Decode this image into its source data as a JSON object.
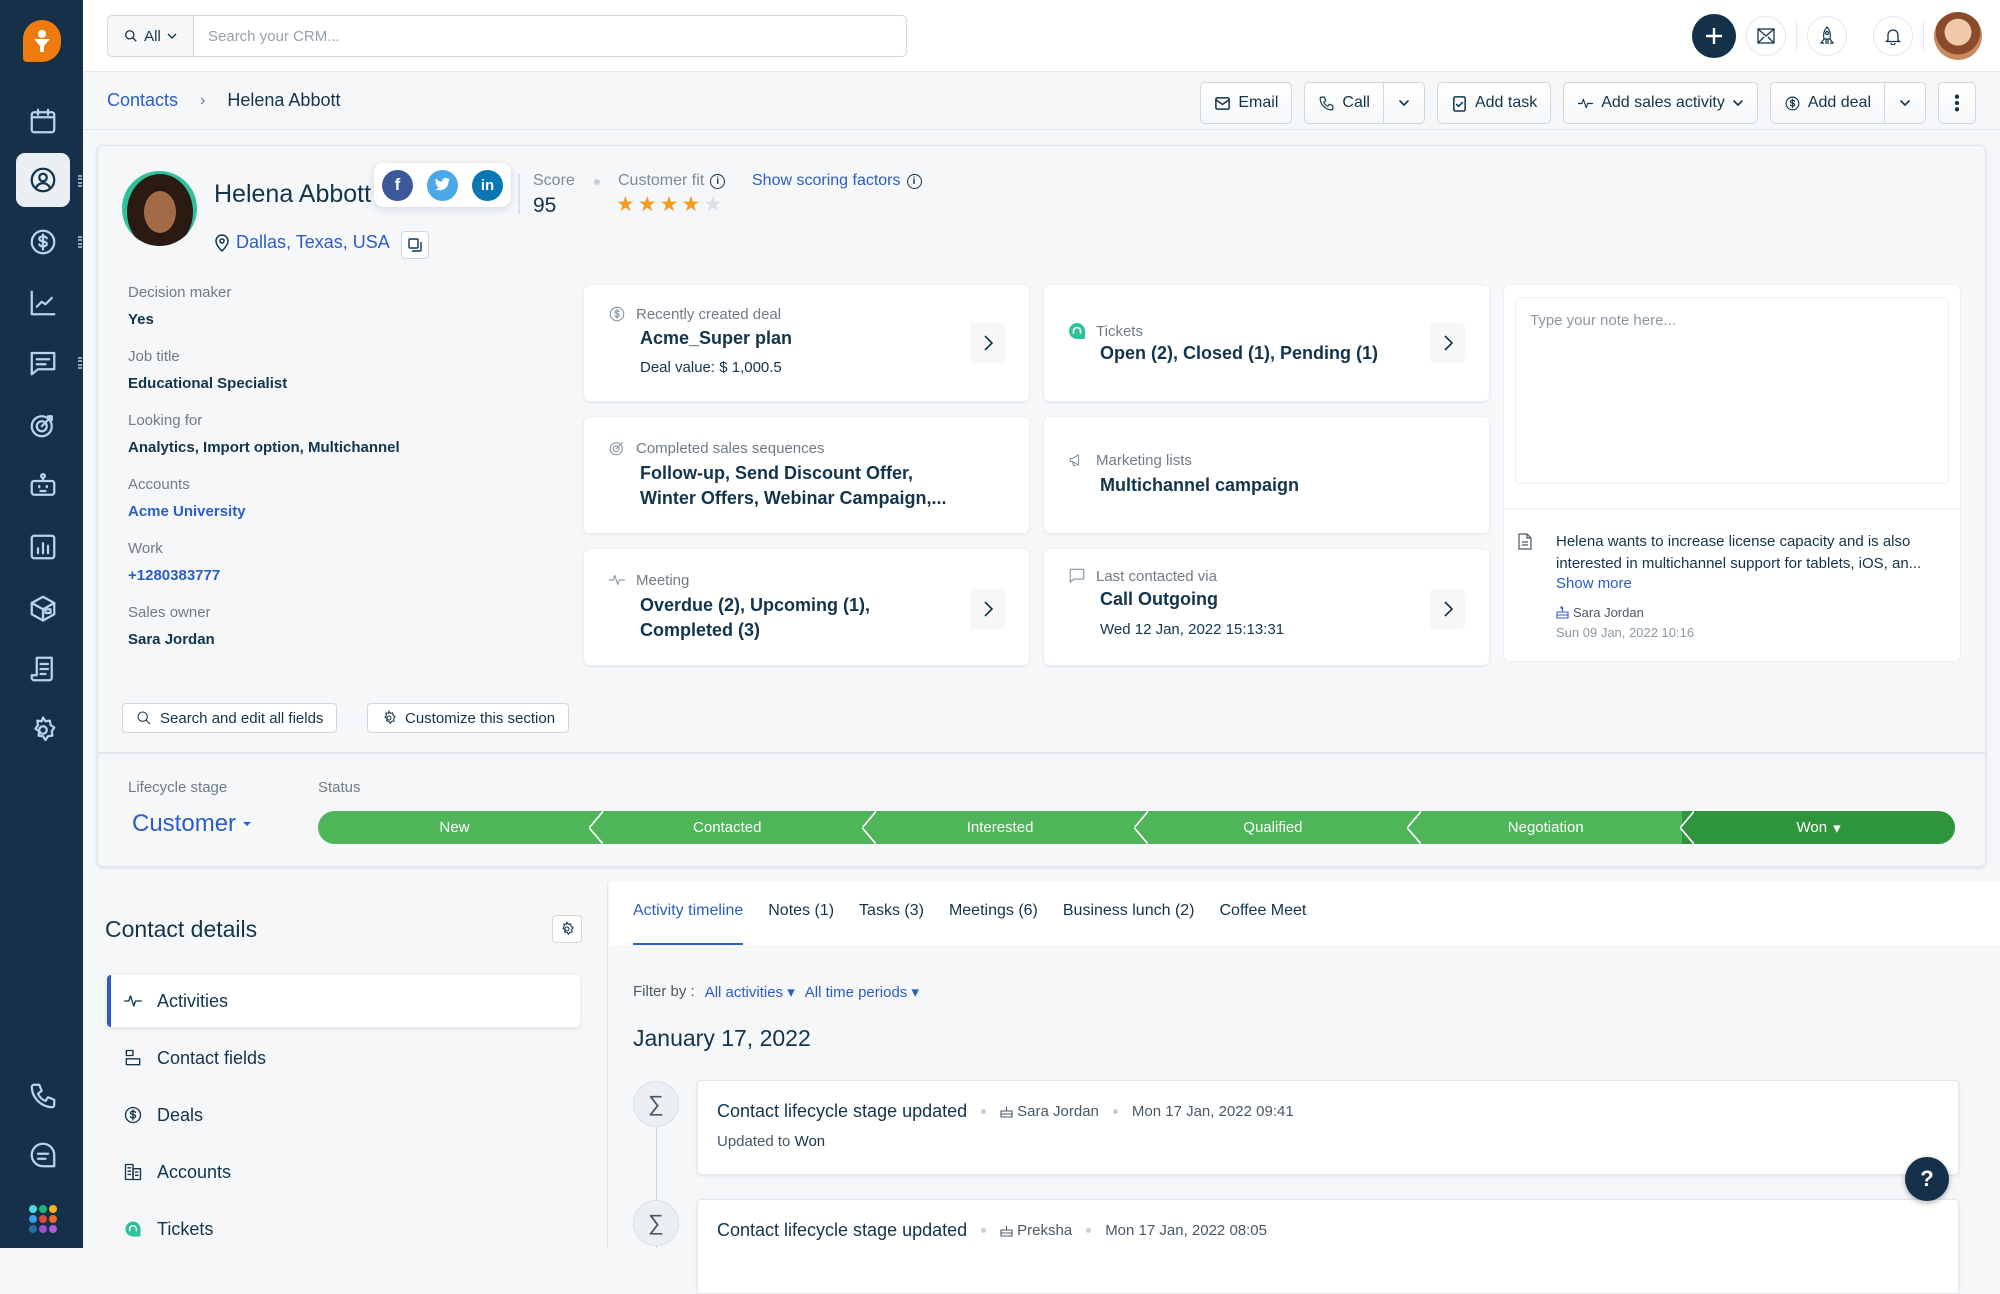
{
  "nav": {
    "items": [
      {
        "icon": "calendar-icon"
      },
      {
        "icon": "contacts-icon",
        "active": true
      },
      {
        "icon": "deals-icon"
      },
      {
        "icon": "analytics-icon"
      },
      {
        "icon": "conversations-icon"
      },
      {
        "icon": "sequences-icon"
      },
      {
        "icon": "bot-icon"
      },
      {
        "icon": "reports-icon"
      },
      {
        "icon": "products-icon"
      },
      {
        "icon": "documents-icon"
      },
      {
        "icon": "settings-icon"
      }
    ],
    "bottom": [
      {
        "icon": "phone-icon"
      },
      {
        "icon": "chat-icon"
      },
      {
        "icon": "apps-grid-icon"
      }
    ]
  },
  "topbar": {
    "search_scope": "All",
    "search_placeholder": "Search your CRM..."
  },
  "breadcrumb": {
    "parent": "Contacts",
    "current": "Helena Abbott"
  },
  "actions": {
    "email": "Email",
    "call": "Call",
    "add_task": "Add task",
    "add_sales_activity": "Add sales activity",
    "add_deal": "Add deal"
  },
  "contact": {
    "name": "Helena Abbott",
    "location": "Dallas, Texas, USA",
    "socials": [
      "facebook",
      "twitter",
      "linkedin"
    ],
    "score_label": "Score",
    "score": "95",
    "fit_label": "Customer fit",
    "fit_rating": 4,
    "fit_max": 5,
    "scoring_link": "Show scoring factors"
  },
  "fields": [
    {
      "label": "Decision maker",
      "value": "Yes"
    },
    {
      "label": "Job title",
      "value": "Educational Specialist"
    },
    {
      "label": "Looking for",
      "value": "Analytics, Import option, Multichannel"
    },
    {
      "label": "Accounts",
      "value": "Acme University",
      "link": true
    },
    {
      "label": "Work",
      "value": "+1280383777",
      "link": true
    },
    {
      "label": "Sales owner",
      "value": "Sara Jordan"
    }
  ],
  "widgets": {
    "deal": {
      "label": "Recently created deal",
      "value": "Acme_Super plan",
      "sub": "Deal value: $ 1,000.5"
    },
    "tickets": {
      "label": "Tickets",
      "value": "Open (2), Closed (1), Pending (1)"
    },
    "sequences": {
      "label": "Completed sales sequences",
      "value1": "Follow-up, Send Discount Offer,",
      "value2": "Winter Offers, Webinar Campaign,..."
    },
    "marketing": {
      "label": "Marketing lists",
      "value": "Multichannel campaign"
    },
    "meeting": {
      "label": "Meeting",
      "value1": "Overdue (2), Upcoming (1),",
      "value2": "Completed (3)"
    },
    "last_contact": {
      "label": "Last contacted via",
      "value": "Call Outgoing",
      "sub": "Wed 12 Jan, 2022 15:13:31"
    }
  },
  "note": {
    "placeholder": "Type your note here...",
    "text": "Helena wants to increase license capacity and is also interested in multichannel support for tablets, iOS, an...",
    "show_more": "Show more",
    "owner": "Sara Jordan",
    "time": "Sun 09 Jan, 2022 10:16"
  },
  "card_buttons": {
    "search_fields": "Search and edit all fields",
    "customize": "Customize this section"
  },
  "lifecycle": {
    "label": "Lifecycle stage",
    "value": "Customer"
  },
  "status": {
    "label": "Status",
    "stages": [
      "New",
      "Contacted",
      "Interested",
      "Qualified",
      "Negotiation",
      "Won"
    ],
    "current": "Won"
  },
  "contact_details": {
    "title": "Contact details",
    "items": [
      {
        "label": "Activities",
        "icon": "activity-icon",
        "active": true
      },
      {
        "label": "Contact fields",
        "icon": "fields-icon"
      },
      {
        "label": "Deals",
        "icon": "deals-icon"
      },
      {
        "label": "Accounts",
        "icon": "accounts-icon"
      },
      {
        "label": "Tickets",
        "icon": "tickets-icon"
      }
    ]
  },
  "timeline": {
    "tabs": [
      "Activity timeline",
      "Notes (1)",
      "Tasks (3)",
      "Meetings (6)",
      "Business lunch (2)",
      "Coffee Meet"
    ],
    "active_tab": "Activity timeline",
    "filter_label": "Filter by :",
    "filter_activities": "All activities",
    "filter_period": "All time periods",
    "date": "January 17, 2022",
    "entries": [
      {
        "title": "Contact lifecycle stage updated",
        "user": "Sara Jordan",
        "time": "Mon 17 Jan, 2022 09:41",
        "sub_label": "Updated to",
        "sub_value": "Won"
      },
      {
        "title": "Contact lifecycle stage updated",
        "user": "Preksha",
        "time": "Mon 17 Jan, 2022 08:05"
      }
    ]
  },
  "help_label": "?"
}
